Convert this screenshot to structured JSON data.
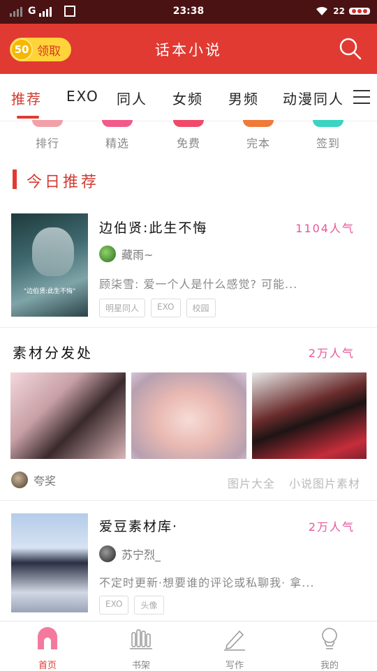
{
  "status_bar": {
    "network": "G",
    "time": "23:38",
    "battery": "22"
  },
  "header": {
    "coin_amount": "50",
    "claim_label": "领取",
    "title": "话本小说"
  },
  "tabs": [
    {
      "label": "推荐"
    },
    {
      "label": "EXO"
    },
    {
      "label": "同人"
    },
    {
      "label": "女频"
    },
    {
      "label": "男频"
    },
    {
      "label": "动漫同人"
    }
  ],
  "shortcuts": [
    {
      "label": "排行",
      "color": "#f2a0a8"
    },
    {
      "label": "精选",
      "color": "#f25a8a"
    },
    {
      "label": "免费",
      "color": "#f04a6a"
    },
    {
      "label": "完本",
      "color": "#f07a3a"
    },
    {
      "label": "签到",
      "color": "#3ad4c0"
    }
  ],
  "section_title": "今日推荐",
  "book1": {
    "title": "边伯贤:此生不悔",
    "popularity": "1104人气",
    "author": "藏雨~",
    "description": "顾柒雪: 爱一个人是什么感觉? 可能...",
    "tags": [
      "明星同人",
      "EXO",
      "校园"
    ],
    "cover_text": "\"边伯贤:此生不悔\""
  },
  "book2": {
    "title": "素材分发处",
    "popularity": "2万人气",
    "author": "夸奖",
    "tags": [
      "图片大全",
      "小说图片素材"
    ]
  },
  "book3": {
    "title": "爱豆素材库·",
    "popularity": "2万人气",
    "author": "苏宁烈_",
    "description": "不定时更新·想要谁的评论或私聊我· 拿...",
    "tags": [
      "EXO",
      "头像"
    ]
  },
  "tabbar": [
    {
      "label": "首页"
    },
    {
      "label": "书架"
    },
    {
      "label": "写作"
    },
    {
      "label": "我的"
    }
  ]
}
